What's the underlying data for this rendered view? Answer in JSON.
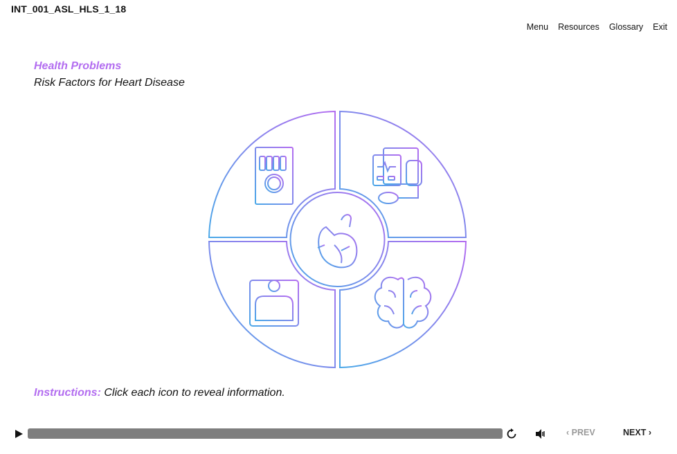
{
  "course_id": "INT_001_ASL_HLS_1_18",
  "nav": {
    "menu": "Menu",
    "resources": "Resources",
    "glossary": "Glossary",
    "exit": "Exit"
  },
  "heading": {
    "title": "Health Problems",
    "subtitle": "Risk Factors for Heart Disease"
  },
  "wheel": {
    "segments": [
      {
        "icon": "cigarette-pack-icon"
      },
      {
        "icon": "blood-pressure-monitor-icon"
      },
      {
        "icon": "weight-scale-icon"
      },
      {
        "icon": "brain-icon"
      }
    ],
    "center_icon": "heart-icon",
    "gradient": [
      "#b36df0",
      "#4aa8e8"
    ]
  },
  "instructions": {
    "label": "Instructions:",
    "text": " Click each icon to reveal information."
  },
  "player": {
    "prev": "PREV",
    "next": "NEXT",
    "progress": 0
  },
  "colors": {
    "accent": "#b36df0",
    "seek_bar": "#7e7e7e"
  }
}
